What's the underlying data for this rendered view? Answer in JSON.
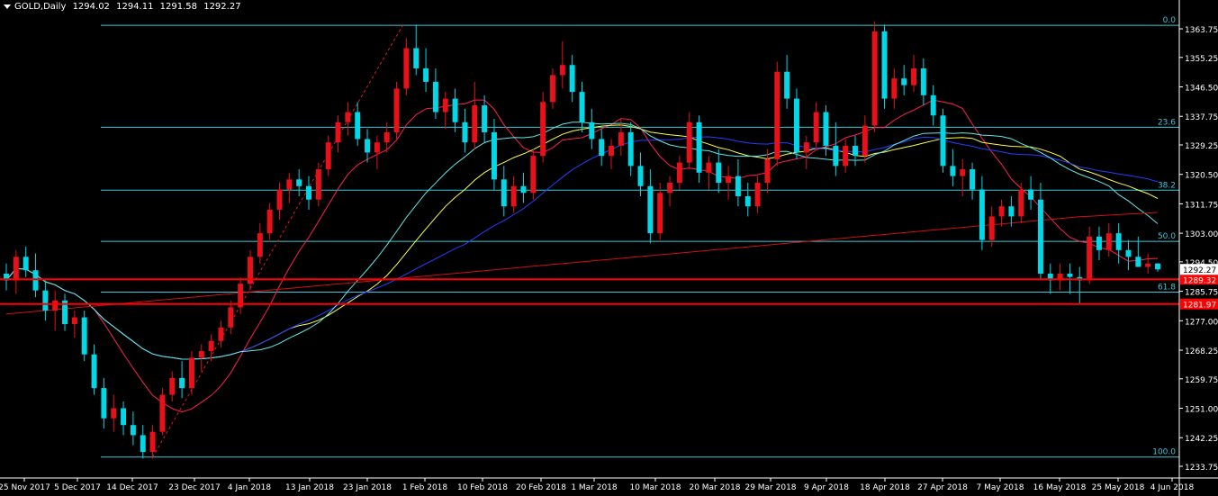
{
  "header": {
    "symbol": "GOLD,Daily",
    "open": "1294.02",
    "high": "1294.11",
    "low": "1291.58",
    "close": "1292.27"
  },
  "colors": {
    "background": "#000000",
    "bull": "#e8101a",
    "bear": "#00d8e8",
    "grid_axis": "#ffffff",
    "fibo": "#40c8d8",
    "support": "#ff0000",
    "ma_red": "#ff2050",
    "ma_yellow": "#ffff40",
    "ma_blue": "#2040ff",
    "ma_cyan": "#60e8e8",
    "ma_long": "#d01010"
  },
  "chart_data": {
    "type": "candlestick",
    "symbol": "GOLD",
    "timeframe": "Daily",
    "y_ticks": [
      "1363.75",
      "1355.25",
      "1346.50",
      "1337.75",
      "1329.25",
      "1320.50",
      "1311.75",
      "1303.00",
      "1294.50",
      "1285.75",
      "1277.00",
      "1268.25",
      "1259.75",
      "1251.00",
      "1242.25",
      "1233.75"
    ],
    "y_range": [
      1233.75,
      1367.5
    ],
    "x_labels": [
      "25 Nov 2017",
      "5 Dec 2017",
      "14 Dec 2017",
      "23 Dec 2017",
      "4 Jan 2018",
      "13 Jan 2018",
      "23 Jan 2018",
      "1 Feb 2018",
      "10 Feb 2018",
      "20 Feb 2018",
      "1 Mar 2018",
      "10 Mar 2018",
      "20 Mar 2018",
      "29 Mar 2018",
      "9 Apr 2018",
      "18 Apr 2018",
      "27 Apr 2018",
      "7 May 2018",
      "16 May 2018",
      "25 May 2018",
      "4 Jun 2018"
    ],
    "current_price": "1292.27",
    "horizontal_lines": [
      {
        "label": "1289.32",
        "value": 1289.32
      },
      {
        "label": "1281.97",
        "value": 1281.97
      }
    ],
    "fibonacci": {
      "high": 1364.8,
      "low": 1236.5,
      "levels": [
        {
          "label": "0.0",
          "value": 1364.8
        },
        {
          "label": "23.6",
          "value": 1334.5
        },
        {
          "label": "38.2",
          "value": 1315.8
        },
        {
          "label": "50.0",
          "value": 1300.6
        },
        {
          "label": "61.8",
          "value": 1285.5
        },
        {
          "label": "100.0",
          "value": 1236.5
        }
      ]
    },
    "candles": [
      [
        1291,
        1294,
        1286,
        1289
      ],
      [
        1289,
        1298,
        1285,
        1296
      ],
      [
        1296,
        1299,
        1290,
        1292
      ],
      [
        1292,
        1297,
        1284,
        1286
      ],
      [
        1286,
        1289,
        1277,
        1280
      ],
      [
        1280,
        1286,
        1274,
        1283
      ],
      [
        1283,
        1285,
        1274,
        1276
      ],
      [
        1276,
        1280,
        1272,
        1278
      ],
      [
        1278,
        1280,
        1265,
        1267
      ],
      [
        1267,
        1270,
        1255,
        1257
      ],
      [
        1257,
        1260,
        1245,
        1248
      ],
      [
        1248,
        1255,
        1244,
        1251
      ],
      [
        1251,
        1253,
        1243,
        1246
      ],
      [
        1246,
        1250,
        1240,
        1243
      ],
      [
        1243,
        1246,
        1236,
        1238
      ],
      [
        1238,
        1246,
        1236,
        1244
      ],
      [
        1244,
        1257,
        1243,
        1255
      ],
      [
        1255,
        1262,
        1253,
        1260
      ],
      [
        1260,
        1265,
        1254,
        1257
      ],
      [
        1257,
        1268,
        1255,
        1266
      ],
      [
        1266,
        1270,
        1262,
        1268
      ],
      [
        1268,
        1273,
        1265,
        1271
      ],
      [
        1271,
        1277,
        1269,
        1275
      ],
      [
        1275,
        1283,
        1273,
        1281
      ],
      [
        1281,
        1290,
        1279,
        1288
      ],
      [
        1288,
        1298,
        1286,
        1296
      ],
      [
        1296,
        1306,
        1294,
        1303
      ],
      [
        1303,
        1312,
        1301,
        1310
      ],
      [
        1310,
        1318,
        1307,
        1316
      ],
      [
        1316,
        1321,
        1312,
        1319
      ],
      [
        1319,
        1322,
        1314,
        1317
      ],
      [
        1317,
        1320,
        1310,
        1313
      ],
      [
        1313,
        1324,
        1311,
        1322
      ],
      [
        1322,
        1332,
        1320,
        1330
      ],
      [
        1330,
        1338,
        1327,
        1336
      ],
      [
        1336,
        1342,
        1332,
        1339
      ],
      [
        1339,
        1342,
        1329,
        1331
      ],
      [
        1331,
        1334,
        1324,
        1327
      ],
      [
        1327,
        1332,
        1322,
        1330
      ],
      [
        1330,
        1336,
        1327,
        1333
      ],
      [
        1333,
        1348,
        1331,
        1346
      ],
      [
        1346,
        1361,
        1344,
        1358
      ],
      [
        1358,
        1365,
        1350,
        1352
      ],
      [
        1352,
        1358,
        1345,
        1348
      ],
      [
        1348,
        1352,
        1337,
        1339
      ],
      [
        1339,
        1345,
        1334,
        1343
      ],
      [
        1343,
        1346,
        1333,
        1336
      ],
      [
        1336,
        1340,
        1327,
        1330
      ],
      [
        1330,
        1348,
        1328,
        1341
      ],
      [
        1341,
        1344,
        1330,
        1333
      ],
      [
        1333,
        1337,
        1316,
        1319
      ],
      [
        1319,
        1323,
        1308,
        1311
      ],
      [
        1311,
        1320,
        1309,
        1317
      ],
      [
        1317,
        1321,
        1312,
        1315
      ],
      [
        1315,
        1328,
        1313,
        1326
      ],
      [
        1326,
        1345,
        1324,
        1342
      ],
      [
        1342,
        1352,
        1340,
        1350
      ],
      [
        1350,
        1360,
        1346,
        1353
      ],
      [
        1353,
        1356,
        1342,
        1345
      ],
      [
        1345,
        1348,
        1333,
        1336
      ],
      [
        1336,
        1340,
        1328,
        1331
      ],
      [
        1331,
        1334,
        1323,
        1326
      ],
      [
        1326,
        1331,
        1322,
        1329
      ],
      [
        1329,
        1337,
        1326,
        1333
      ],
      [
        1333,
        1336,
        1320,
        1323
      ],
      [
        1323,
        1327,
        1314,
        1317
      ],
      [
        1317,
        1322,
        1300,
        1303
      ],
      [
        1303,
        1318,
        1301,
        1315
      ],
      [
        1315,
        1320,
        1311,
        1318
      ],
      [
        1318,
        1326,
        1316,
        1324
      ],
      [
        1324,
        1339,
        1322,
        1336
      ],
      [
        1336,
        1338,
        1318,
        1321
      ],
      [
        1321,
        1326,
        1316,
        1324
      ],
      [
        1324,
        1328,
        1315,
        1318
      ],
      [
        1318,
        1323,
        1313,
        1320
      ],
      [
        1320,
        1325,
        1311,
        1314
      ],
      [
        1314,
        1318,
        1308,
        1311
      ],
      [
        1311,
        1320,
        1309,
        1318
      ],
      [
        1318,
        1328,
        1315,
        1325
      ],
      [
        1325,
        1354,
        1323,
        1351
      ],
      [
        1351,
        1356,
        1340,
        1343
      ],
      [
        1343,
        1346,
        1325,
        1327
      ],
      [
        1327,
        1332,
        1322,
        1330
      ],
      [
        1330,
        1342,
        1328,
        1339
      ],
      [
        1339,
        1341,
        1326,
        1329
      ],
      [
        1329,
        1336,
        1320,
        1323
      ],
      [
        1323,
        1331,
        1321,
        1329
      ],
      [
        1329,
        1332,
        1323,
        1326
      ],
      [
        1326,
        1338,
        1324,
        1335
      ],
      [
        1335,
        1366,
        1333,
        1363
      ],
      [
        1363,
        1365,
        1340,
        1343
      ],
      [
        1343,
        1352,
        1340,
        1349
      ],
      [
        1349,
        1353,
        1344,
        1347
      ],
      [
        1347,
        1356,
        1345,
        1352
      ],
      [
        1352,
        1355,
        1341,
        1344
      ],
      [
        1344,
        1347,
        1335,
        1338
      ],
      [
        1338,
        1340,
        1321,
        1323
      ],
      [
        1323,
        1328,
        1317,
        1320
      ],
      [
        1320,
        1325,
        1314,
        1322
      ],
      [
        1322,
        1324,
        1313,
        1316
      ],
      [
        1316,
        1320,
        1298,
        1301
      ],
      [
        1301,
        1311,
        1299,
        1308
      ],
      [
        1308,
        1313,
        1305,
        1311
      ],
      [
        1311,
        1314,
        1305,
        1308
      ],
      [
        1308,
        1318,
        1306,
        1316
      ],
      [
        1316,
        1320,
        1310,
        1313
      ],
      [
        1313,
        1318,
        1289,
        1291
      ],
      [
        1291,
        1294,
        1285,
        1289
      ],
      [
        1289,
        1294,
        1286,
        1291
      ],
      [
        1291,
        1294,
        1285,
        1290
      ],
      [
        1290,
        1293,
        1282,
        1289
      ],
      [
        1289,
        1305,
        1288,
        1302
      ],
      [
        1302,
        1305,
        1295,
        1298
      ],
      [
        1298,
        1306,
        1296,
        1303
      ],
      [
        1303,
        1306,
        1294,
        1298
      ],
      [
        1298,
        1301,
        1292,
        1296
      ],
      [
        1296,
        1302,
        1294,
        1293
      ],
      [
        1293,
        1297,
        1291,
        1294
      ],
      [
        1294.02,
        1294.11,
        1291.58,
        1292.27
      ]
    ],
    "moving_averages": [
      {
        "color": "#ff2050",
        "period": 10
      },
      {
        "color": "#ffff40",
        "period": 30
      },
      {
        "color": "#2040ff",
        "period": 40
      },
      {
        "color": "#60e8e8",
        "period": 25
      },
      {
        "color": "#d01010",
        "period": 200
      }
    ]
  }
}
